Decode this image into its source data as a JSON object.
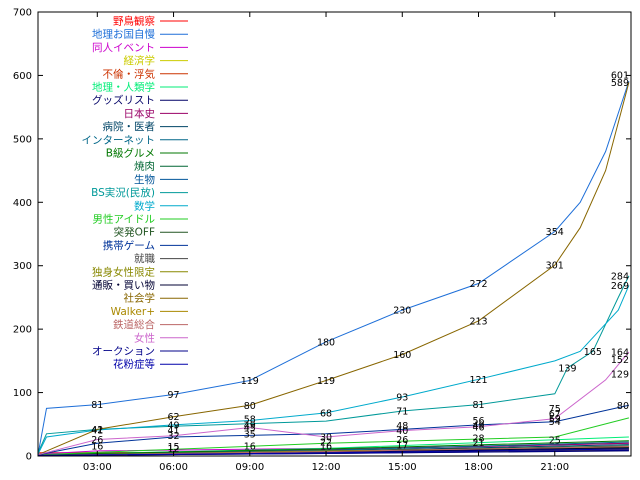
{
  "chart_data": {
    "type": "line",
    "title": "",
    "xlabel": "",
    "ylabel": "",
    "ylim": [
      0,
      700
    ],
    "xlim": [
      "00:40",
      "24:00"
    ],
    "x_ticks": [
      "03:00",
      "06:00",
      "09:00",
      "12:00",
      "15:00",
      "18:00",
      "21:00"
    ],
    "y_ticks": [
      0,
      100,
      200,
      300,
      400,
      500,
      600,
      700
    ],
    "grid": false,
    "legend_position": "top-left",
    "series": [
      {
        "name": "野鳥観察",
        "color": "#ff0000",
        "points": [
          [
            "00:40",
            5
          ],
          [
            "12:00",
            6
          ],
          [
            "18:00",
            7
          ],
          [
            "22:00",
            8
          ],
          [
            "23:55",
            10
          ]
        ]
      },
      {
        "name": "地理お国自慢",
        "color": "#1e6fd8",
        "points": [
          [
            "00:40",
            2
          ],
          [
            "01:00",
            75
          ],
          [
            "03:00",
            81
          ],
          [
            "06:00",
            97
          ],
          [
            "09:00",
            119
          ],
          [
            "12:00",
            180
          ],
          [
            "15:00",
            230
          ],
          [
            "18:00",
            272
          ],
          [
            "21:00",
            354
          ],
          [
            "22:00",
            400
          ],
          [
            "23:00",
            480
          ],
          [
            "23:55",
            591
          ]
        ]
      },
      {
        "name": "同人イベント",
        "color": "#cc00cc",
        "points": [
          [
            "00:40",
            3
          ],
          [
            "03:00",
            8
          ],
          [
            "12:00",
            12
          ],
          [
            "18:00",
            15
          ],
          [
            "23:55",
            20
          ]
        ]
      },
      {
        "name": "経済学",
        "color": "#cccc00",
        "points": [
          [
            "00:40",
            2
          ],
          [
            "12:00",
            6
          ],
          [
            "23:55",
            12
          ]
        ]
      },
      {
        "name": "不倫・浮気",
        "color": "#cc3300",
        "points": [
          [
            "00:40",
            2
          ],
          [
            "12:00",
            8
          ],
          [
            "23:55",
            15
          ]
        ]
      },
      {
        "name": "地理・人類学",
        "color": "#00ee77",
        "points": [
          [
            "00:40",
            2
          ],
          [
            "12:00",
            12
          ],
          [
            "23:55",
            30
          ]
        ]
      },
      {
        "name": "グッズリスト",
        "color": "#000066",
        "points": [
          [
            "00:40",
            1
          ],
          [
            "12:00",
            4
          ],
          [
            "23:55",
            8
          ]
        ]
      },
      {
        "name": "日本史",
        "color": "#990066",
        "points": [
          [
            "00:40",
            2
          ],
          [
            "12:00",
            10
          ],
          [
            "23:55",
            20
          ]
        ]
      },
      {
        "name": "病院・医者",
        "color": "#004466",
        "points": [
          [
            "00:40",
            1
          ],
          [
            "12:00",
            8
          ],
          [
            "23:55",
            18
          ]
        ]
      },
      {
        "name": "インターネット",
        "color": "#006688",
        "points": [
          [
            "00:40",
            2
          ],
          [
            "12:00",
            9
          ],
          [
            "23:55",
            22
          ]
        ]
      },
      {
        "name": "B級グルメ",
        "color": "#007700",
        "points": [
          [
            "00:40",
            2
          ],
          [
            "12:00",
            11
          ],
          [
            "23:55",
            24
          ]
        ]
      },
      {
        "name": "焼肉",
        "color": "#006633",
        "points": [
          [
            "00:40",
            1
          ],
          [
            "12:00",
            7
          ],
          [
            "23:55",
            16
          ]
        ]
      },
      {
        "name": "生物",
        "color": "#005599",
        "points": [
          [
            "00:40",
            1
          ],
          [
            "12:00",
            6
          ],
          [
            "23:55",
            14
          ]
        ]
      },
      {
        "name": "BS実況(民放)",
        "color": "#009999",
        "points": [
          [
            "00:40",
            5
          ],
          [
            "01:00",
            35
          ],
          [
            "03:00",
            42
          ],
          [
            "06:00",
            47
          ],
          [
            "12:00",
            55
          ],
          [
            "15:00",
            71
          ],
          [
            "18:00",
            81
          ],
          [
            "21:00",
            98
          ],
          [
            "21:30",
            139
          ],
          [
            "22:30",
            165
          ],
          [
            "23:30",
            250
          ],
          [
            "23:55",
            284
          ]
        ]
      },
      {
        "name": "数学",
        "color": "#00aacc",
        "points": [
          [
            "00:40",
            3
          ],
          [
            "01:00",
            30
          ],
          [
            "03:00",
            41
          ],
          [
            "06:00",
            49
          ],
          [
            "09:00",
            56
          ],
          [
            "12:00",
            68
          ],
          [
            "15:00",
            93
          ],
          [
            "18:00",
            121
          ],
          [
            "21:00",
            150
          ],
          [
            "22:00",
            165
          ],
          [
            "23:30",
            230
          ],
          [
            "23:55",
            269
          ]
        ]
      },
      {
        "name": "男性アイドル",
        "color": "#22cc22",
        "points": [
          [
            "00:40",
            2
          ],
          [
            "12:00",
            20
          ],
          [
            "21:00",
            30
          ],
          [
            "23:55",
            60
          ]
        ]
      },
      {
        "name": "突発OFF",
        "color": "#225522",
        "points": [
          [
            "00:40",
            1
          ],
          [
            "12:00",
            5
          ],
          [
            "23:55",
            10
          ]
        ]
      },
      {
        "name": "携帯ゲーム",
        "color": "#003399",
        "points": [
          [
            "00:40",
            2
          ],
          [
            "03:00",
            20
          ],
          [
            "06:00",
            30
          ],
          [
            "12:00",
            35
          ],
          [
            "15:00",
            42
          ],
          [
            "18:00",
            49
          ],
          [
            "21:00",
            54
          ],
          [
            "23:55",
            80
          ]
        ]
      },
      {
        "name": "就職",
        "color": "#444444",
        "points": [
          [
            "00:40",
            1
          ],
          [
            "12:00",
            6
          ],
          [
            "23:55",
            12
          ]
        ]
      },
      {
        "name": "独身女性限定",
        "color": "#888800",
        "points": [
          [
            "00:40",
            1
          ],
          [
            "12:00",
            8
          ],
          [
            "23:55",
            14
          ]
        ]
      },
      {
        "name": "通販・買い物",
        "color": "#000033",
        "points": [
          [
            "00:40",
            1
          ],
          [
            "12:00",
            6
          ],
          [
            "23:55",
            13
          ]
        ]
      },
      {
        "name": "社会学",
        "color": "#886600",
        "points": [
          [
            "00:40",
            2
          ],
          [
            "03:00",
            42
          ],
          [
            "06:00",
            62
          ],
          [
            "09:00",
            80
          ],
          [
            "12:00",
            119
          ],
          [
            "15:00",
            160
          ],
          [
            "18:00",
            213
          ],
          [
            "21:00",
            301
          ],
          [
            "22:00",
            360
          ],
          [
            "23:00",
            450
          ],
          [
            "23:55",
            589
          ]
        ]
      },
      {
        "name": "Walker+",
        "color": "#aa8800",
        "points": [
          [
            "00:40",
            1
          ],
          [
            "12:00",
            5
          ],
          [
            "23:55",
            10
          ]
        ]
      },
      {
        "name": "鉄道総合",
        "color": "#bb6666",
        "points": [
          [
            "00:40",
            1
          ],
          [
            "12:00",
            7
          ],
          [
            "23:55",
            15
          ]
        ]
      },
      {
        "name": "女性",
        "color": "#cc66cc",
        "points": [
          [
            "00:40",
            2
          ],
          [
            "03:00",
            26
          ],
          [
            "06:00",
            32
          ],
          [
            "09:00",
            45
          ],
          [
            "12:00",
            30
          ],
          [
            "15:00",
            40
          ],
          [
            "18:00",
            46
          ],
          [
            "21:00",
            59
          ],
          [
            "23:00",
            120
          ],
          [
            "23:55",
            164
          ]
        ]
      },
      {
        "name": "オークション",
        "color": "#000088",
        "points": [
          [
            "00:40",
            1
          ],
          [
            "12:00",
            4
          ],
          [
            "23:55",
            9
          ]
        ]
      },
      {
        "name": "花粉症等",
        "color": "#0000aa",
        "points": [
          [
            "00:40",
            1
          ],
          [
            "12:00",
            5
          ],
          [
            "23:55",
            11
          ]
        ]
      }
    ],
    "annotations": [
      {
        "x": "03:00",
        "y": 81,
        "text": "81"
      },
      {
        "x": "06:00",
        "y": 97,
        "text": "97"
      },
      {
        "x": "09:00",
        "y": 119,
        "text": "119"
      },
      {
        "x": "12:00",
        "y": 180,
        "text": "180"
      },
      {
        "x": "15:00",
        "y": 230,
        "text": "230"
      },
      {
        "x": "18:00",
        "y": 272,
        "text": "272"
      },
      {
        "x": "21:00",
        "y": 354,
        "text": "354"
      },
      {
        "x": "23:55",
        "y": 601,
        "text": "601"
      },
      {
        "x": "23:55",
        "y": 589,
        "text": "589"
      },
      {
        "x": "09:00",
        "y": 80,
        "text": "80"
      },
      {
        "x": "12:00",
        "y": 119,
        "text": "119"
      },
      {
        "x": "15:00",
        "y": 160,
        "text": "160"
      },
      {
        "x": "18:00",
        "y": 213,
        "text": "213"
      },
      {
        "x": "21:00",
        "y": 301,
        "text": "301"
      },
      {
        "x": "23:55",
        "y": 284,
        "text": "284"
      },
      {
        "x": "23:55",
        "y": 269,
        "text": "269"
      },
      {
        "x": "22:30",
        "y": 165,
        "text": "165"
      },
      {
        "x": "21:30",
        "y": 139,
        "text": "139"
      },
      {
        "x": "23:55",
        "y": 164,
        "text": "164"
      },
      {
        "x": "23:55",
        "y": 152,
        "text": "152"
      },
      {
        "x": "23:55",
        "y": 129,
        "text": "129"
      },
      {
        "x": "18:00",
        "y": 121,
        "text": "121"
      },
      {
        "x": "15:00",
        "y": 93,
        "text": "93"
      },
      {
        "x": "18:00",
        "y": 81,
        "text": "81"
      },
      {
        "x": "15:00",
        "y": 71,
        "text": "71"
      },
      {
        "x": "23:55",
        "y": 80,
        "text": "80"
      },
      {
        "x": "03:00",
        "y": 42,
        "text": "42"
      },
      {
        "x": "06:00",
        "y": 62,
        "text": "62"
      },
      {
        "x": "09:00",
        "y": 58,
        "text": "58"
      },
      {
        "x": "12:00",
        "y": 68,
        "text": "68"
      },
      {
        "x": "06:00",
        "y": 49,
        "text": "49"
      },
      {
        "x": "09:00",
        "y": 49,
        "text": "49"
      },
      {
        "x": "03:00",
        "y": 41,
        "text": "41"
      },
      {
        "x": "06:00",
        "y": 41,
        "text": "41"
      },
      {
        "x": "09:00",
        "y": 45,
        "text": "45"
      },
      {
        "x": "15:00",
        "y": 48,
        "text": "48"
      },
      {
        "x": "18:00",
        "y": 56,
        "text": "56"
      },
      {
        "x": "18:00",
        "y": 49,
        "text": "49"
      },
      {
        "x": "21:00",
        "y": 75,
        "text": "75"
      },
      {
        "x": "21:00",
        "y": 67,
        "text": "67"
      },
      {
        "x": "21:00",
        "y": 54,
        "text": "54"
      },
      {
        "x": "03:00",
        "y": 26,
        "text": "26"
      },
      {
        "x": "06:00",
        "y": 32,
        "text": "32"
      },
      {
        "x": "09:00",
        "y": 35,
        "text": "35"
      },
      {
        "x": "12:00",
        "y": 30,
        "text": "30"
      },
      {
        "x": "15:00",
        "y": 40,
        "text": "40"
      },
      {
        "x": "18:00",
        "y": 46,
        "text": "46"
      },
      {
        "x": "21:00",
        "y": 59,
        "text": "59"
      },
      {
        "x": "03:00",
        "y": 16,
        "text": "16"
      },
      {
        "x": "06:00",
        "y": 15,
        "text": "15"
      },
      {
        "x": "09:00",
        "y": 16,
        "text": "16"
      },
      {
        "x": "12:00",
        "y": 22,
        "text": "22"
      },
      {
        "x": "15:00",
        "y": 26,
        "text": "26"
      },
      {
        "x": "18:00",
        "y": 28,
        "text": "28"
      },
      {
        "x": "06:00",
        "y": 12,
        "text": "12"
      },
      {
        "x": "12:00",
        "y": 16,
        "text": "16"
      },
      {
        "x": "15:00",
        "y": 17,
        "text": "17"
      },
      {
        "x": "18:00",
        "y": 21,
        "text": "21"
      },
      {
        "x": "21:00",
        "y": 25,
        "text": "25"
      }
    ]
  }
}
